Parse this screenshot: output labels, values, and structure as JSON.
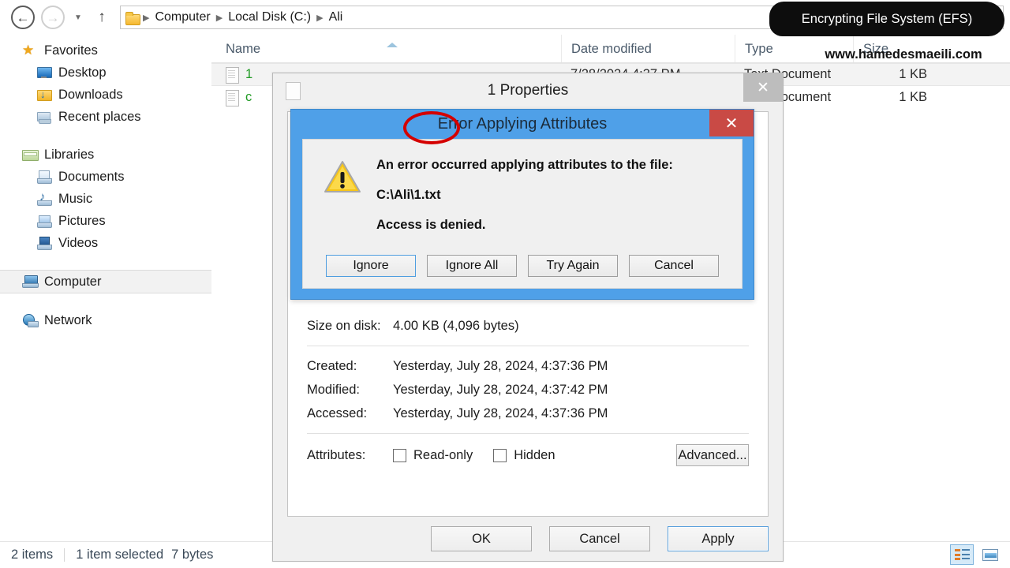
{
  "window": {
    "type": "windows-file-explorer",
    "address": {
      "crumbs": [
        "Computer",
        "Local Disk (C:)",
        "Ali"
      ],
      "folder_icon": "folder-icon",
      "dropdown_icon": "chevron-down-icon",
      "refresh_icon": "refresh-icon"
    },
    "nav": {
      "back_icon": "back-arrow-icon",
      "forward_icon": "forward-arrow-icon",
      "recent_icon": "chevron-down-icon",
      "up_icon": "up-arrow-icon"
    }
  },
  "sidebar": {
    "groups": [
      {
        "header": {
          "label": "Favorites",
          "icon": "star-icon",
          "icon_class": "ico-star"
        },
        "items": [
          {
            "label": "Desktop",
            "icon": "desktop-icon",
            "icon_class": "ico-desktop"
          },
          {
            "label": "Downloads",
            "icon": "downloads-folder-icon",
            "icon_class": "ico-dl"
          },
          {
            "label": "Recent places",
            "icon": "recent-places-icon",
            "icon_class": "ico-recent"
          }
        ]
      },
      {
        "header": {
          "label": "Libraries",
          "icon": "libraries-icon",
          "icon_class": "ico-lib"
        },
        "items": [
          {
            "label": "Documents",
            "icon": "documents-library-icon",
            "icon_class": "ico-doc"
          },
          {
            "label": "Music",
            "icon": "music-library-icon",
            "icon_class": "ico-music"
          },
          {
            "label": "Pictures",
            "icon": "pictures-library-icon",
            "icon_class": "ico-pic"
          },
          {
            "label": "Videos",
            "icon": "videos-library-icon",
            "icon_class": "ico-vid"
          }
        ]
      }
    ],
    "computer": {
      "label": "Computer",
      "icon": "computer-icon",
      "icon_class": "ico-comp",
      "selected": true
    },
    "network": {
      "label": "Network",
      "icon": "network-globe-icon",
      "icon_class": "ico-net"
    }
  },
  "filelist": {
    "columns": [
      "Name",
      "Date modified",
      "Type",
      "Size"
    ],
    "sort_column": "Name",
    "sort_direction": "ascending",
    "rows": [
      {
        "name": "1",
        "date": "7/28/2024 4:37 PM",
        "type": "Text Document",
        "size": "1 KB",
        "selected": true
      },
      {
        "name": "c",
        "date": "",
        "type": "Text Document",
        "size": "1 KB",
        "selected": false
      }
    ]
  },
  "statusbar": {
    "item_count": "2 items",
    "selection": "1 item selected",
    "selection_size": "7 bytes",
    "views": {
      "details_icon": "details-view-icon",
      "tile_icon": "tiles-view-icon",
      "active": "details-view-icon"
    }
  },
  "properties_dialog": {
    "title": "1 Properties",
    "icon": "text-file-icon",
    "close_label": "✕",
    "fields": [
      {
        "label": "Size on disk:",
        "value": "4.00 KB (4,096 bytes)"
      },
      {
        "label": "Created:",
        "value": "Yesterday, July 28, 2024, 4:37:36 PM"
      },
      {
        "label": "Modified:",
        "value": "Yesterday, July 28, 2024, 4:37:42 PM"
      },
      {
        "label": "Accessed:",
        "value": "Yesterday, July 28, 2024, 4:37:36 PM"
      }
    ],
    "attributes": {
      "label": "Attributes:",
      "readonly": {
        "label": "Read-only",
        "checked": false
      },
      "hidden": {
        "label": "Hidden",
        "checked": false
      },
      "advanced_button": "Advanced..."
    },
    "buttons": {
      "ok": "OK",
      "cancel": "Cancel",
      "apply": "Apply",
      "default_focus": "Apply"
    }
  },
  "error_dialog": {
    "title": "Error Applying Attributes",
    "close_label": "✕",
    "icon": "warning-triangle-icon",
    "messages": [
      "An error occurred applying attributes to the file:",
      "C:\\Ali\\1.txt",
      "Access is denied."
    ],
    "buttons": [
      {
        "label": "Ignore",
        "focused": true
      },
      {
        "label": "Ignore All",
        "focused": false
      },
      {
        "label": "Try Again",
        "focused": false
      },
      {
        "label": "Cancel",
        "focused": false
      }
    ]
  },
  "annotations": {
    "callout_label": "Encrypting File System (EFS)",
    "watermark": "www.hamedesmaeili.com",
    "highlight_target": "Error",
    "colors": {
      "callout_bg": "#0d0d0d",
      "highlight_ring": "#d40000",
      "dialog_titlebar": "#4fa0e8",
      "close_button": "#c94a45",
      "encrypted_filename": "#1f9a23"
    }
  }
}
